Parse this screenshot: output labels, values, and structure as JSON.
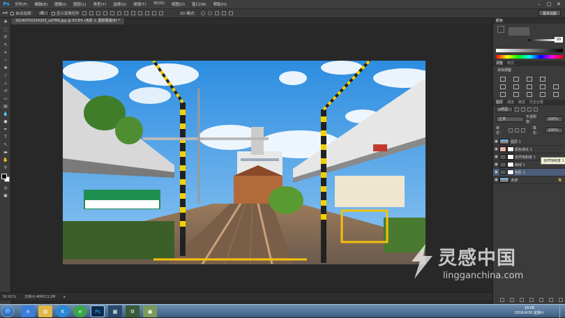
{
  "app": {
    "logo": "Ps"
  },
  "menu": [
    "文件(F)",
    "编辑(E)",
    "图像(I)",
    "图层(L)",
    "类型(Y)",
    "选择(S)",
    "滤镜(T)",
    "3D(D)",
    "视图(V)",
    "窗口(W)",
    "帮助(H)"
  ],
  "options": {
    "auto_select_label": "自动选择：",
    "auto_select_value": "组",
    "show_transform_label": "显示变换控件",
    "mode_3d_label": "3D 模式："
  },
  "workspace": {
    "label": "基本功能"
  },
  "document": {
    "tab_title": "20140702224320_udTMS.jpg @ 50.8% (色阶 1, 图层蒙版/8) *"
  },
  "status": {
    "zoom": "50.61%",
    "doc_size": "文档:6.46M/13.2M"
  },
  "right_dock": {
    "color_tab": "颜色",
    "color_value": "99",
    "adjust_tabs": [
      "调整",
      "样式"
    ],
    "add_adjustment": "添加调整",
    "layers_tabs": [
      "图层",
      "通道",
      "路径",
      "历史记录"
    ],
    "kind_label": "ρ类型",
    "blend_mode": "正常",
    "opacity_label": "不透明度：",
    "opacity_value": "100%",
    "lock_label": "锁定：",
    "fill_label": "填充：",
    "fill_value": "100%",
    "layers": [
      {
        "name": "图层 1"
      },
      {
        "name": "颜色填充 1"
      },
      {
        "name": "自然饱和度 1"
      },
      {
        "name": "曲线 1"
      },
      {
        "name": "色阶 1"
      },
      {
        "name": "背景"
      }
    ],
    "tooltip": "自然饱和度 1"
  },
  "taskbar": {
    "apps": [
      "start",
      "ie",
      "folder",
      "k-app",
      "browser",
      "Ps",
      "media",
      "tools",
      "map"
    ],
    "time": "18:08",
    "date": "2016/4/30 星期六"
  },
  "watermark": {
    "title": "灵感中国",
    "subtitle": "lingganchina.com"
  },
  "colors": {
    "accent": "#31a8ff",
    "panel": "#3b3b3b",
    "workspace": "#282828",
    "selected_layer": "#4d5e7a"
  }
}
